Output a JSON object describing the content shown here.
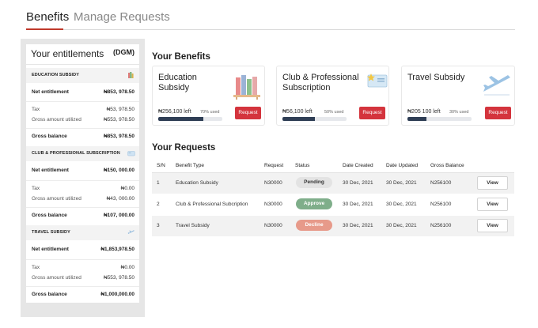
{
  "tabs": [
    {
      "label": "Benefits"
    },
    {
      "label": "Manage Requests"
    }
  ],
  "sidebar": {
    "title": "Your entitlements",
    "badge": "(DGM)",
    "sections": [
      {
        "label": "EDUCATION SUBSIDY",
        "icon": "books-icon",
        "net_label": "Net entitlement",
        "net_value": "₦853, 978.50",
        "tax_label": "Tax",
        "tax_value": "₦53, 978.50",
        "gross_util_label": "Gross amount utilized",
        "gross_util_value": "₦553, 978.50",
        "balance_label": "Gross balance",
        "balance_value": "₦853, 978.50"
      },
      {
        "label": "CLUB & PROFESSIONAL SUBSCRIPTION",
        "icon": "card-icon",
        "net_label": "Net entitlement",
        "net_value": "₦150, 000.00",
        "tax_label": "Tax",
        "tax_value": "₦0.00",
        "gross_util_label": "Gross amount utilized",
        "gross_util_value": "₦43, 000.00",
        "balance_label": "Gross balance",
        "balance_value": "₦107, 000.00"
      },
      {
        "label": "TRAVEL SUBSIDY",
        "icon": "plane-icon",
        "net_label": "Net entitlement",
        "net_value": "₦1,853,978.50",
        "tax_label": "Tax",
        "tax_value": "₦0.00",
        "gross_util_label": "Gross amount utilized",
        "gross_util_value": "₦553, 978.50",
        "balance_label": "Gross balance",
        "balance_value": "₦1,000,000.00"
      }
    ]
  },
  "benefits": {
    "heading": "Your Benefits",
    "cards": [
      {
        "title": "Education Subsidy",
        "left": "₦256,100 left",
        "pct_label": "70% used",
        "used_fraction": 0.7,
        "button": "Request",
        "icon": "books-icon"
      },
      {
        "title": "Club & Professional Subscription",
        "left": "₦56,100 left",
        "pct_label": "50% used",
        "used_fraction": 0.5,
        "button": "Request",
        "icon": "card-icon"
      },
      {
        "title": "Travel Subsidy",
        "left": "₦205 100 left",
        "pct_label": "30% used",
        "used_fraction": 0.3,
        "button": "Request",
        "icon": "plane-icon"
      }
    ]
  },
  "requests": {
    "heading": "Your Requests",
    "columns": [
      "S/N",
      "Benefit Type",
      "Request",
      "Status",
      "Date Created",
      "Date Updated",
      "Gross Balance"
    ],
    "rows": [
      {
        "sn": "1",
        "type": "Education Subsidy",
        "request": "N30000",
        "status": "Pending",
        "created": "30 Dec, 2021",
        "updated": "30 Dec, 2021",
        "balance": "N256100",
        "action": "View"
      },
      {
        "sn": "2",
        "type": "Club & Professional Subcription",
        "request": "N30000",
        "status": "Approve",
        "created": "30 Dec, 2021",
        "updated": "30 Dec, 2021",
        "balance": "N256100",
        "action": "View"
      },
      {
        "sn": "3",
        "type": "Travel Subsidy",
        "request": "N30000",
        "status": "Decline",
        "created": "30 Dec, 2021",
        "updated": "30 Dec, 2021",
        "balance": "N256100",
        "action": "View"
      }
    ]
  },
  "colors": {
    "accent_red": "#d4343d",
    "bar_fill": "#2f3e55",
    "approve": "#7fae8a",
    "decline": "#e79a8a",
    "pending": "#e3e3e3"
  }
}
